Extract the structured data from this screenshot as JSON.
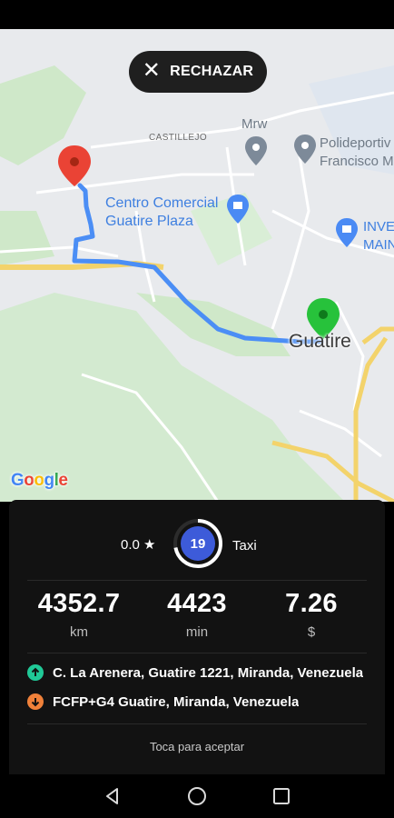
{
  "header": {
    "reject_label": "RECHAZAR"
  },
  "map": {
    "labels": {
      "castillejo": "CASTILLEJO",
      "mrw": "Mrw",
      "polideportivo_1": "Polideportiv",
      "polideportivo_2": "Francisco M",
      "centro_1": "Centro Comercial",
      "centro_2": "Guatire Plaza",
      "inve_1": "INVE",
      "inve_2": "MAIN",
      "guatire": "Guatire"
    },
    "google": [
      "G",
      "o",
      "o",
      "g",
      "l",
      "e"
    ]
  },
  "trip": {
    "rating": "0.0 ★",
    "countdown": "19",
    "countdown_fraction": 0.72,
    "service": "Taxi",
    "stats": [
      {
        "value": "4352.7",
        "unit": "km"
      },
      {
        "value": "4423",
        "unit": "min"
      },
      {
        "value": "7.26",
        "unit": "$"
      }
    ],
    "pickup": "C. La Arenera, Guatire 1221, Miranda, Venezuela",
    "dropoff": "FCFP+G4 Guatire, Miranda, Venezuela",
    "accept_hint": "Toca para aceptar"
  },
  "colors": {
    "route": "#4b8ef5",
    "pickup": "#20c997",
    "dropoff": "#f0813a",
    "timer": "#3d5bd9"
  }
}
